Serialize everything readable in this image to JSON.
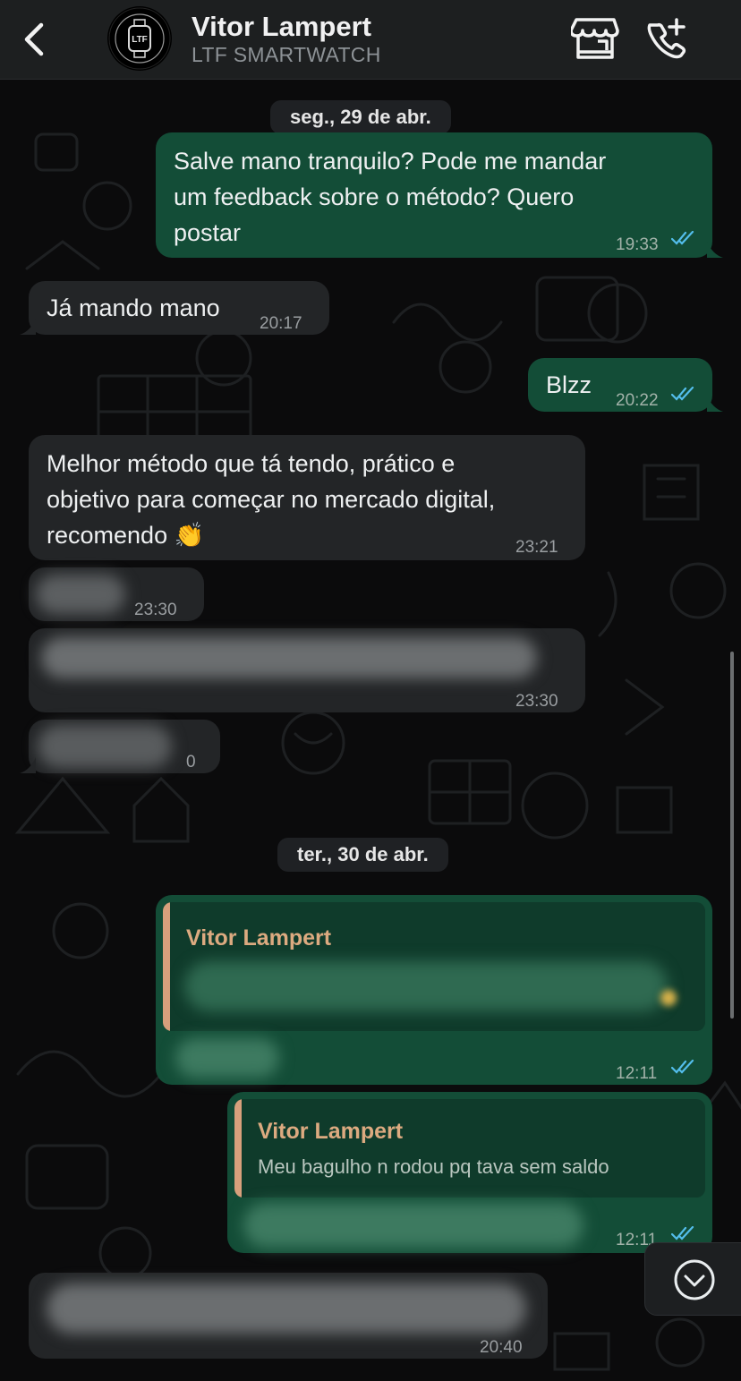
{
  "header": {
    "back_icon": "chevron-left-icon",
    "avatar_text": "LTF",
    "contact_name": "Vitor Lampert",
    "contact_subtitle": "LTF SMARTWATCH",
    "store_icon": "storefront-icon",
    "call_icon": "add-call-icon"
  },
  "dates": {
    "day1": "seg., 29 de abr.",
    "day2": "ter., 30 de abr."
  },
  "messages": [
    {
      "dir": "out",
      "text": "Salve mano tranquilo? Pode me mandar um feedback sobre o método? Quero postar",
      "time": "19:33",
      "status": "read"
    },
    {
      "dir": "in",
      "text": "Já mando mano",
      "time": "20:17"
    },
    {
      "dir": "out",
      "text": "Blzz",
      "time": "20:22",
      "status": "read"
    },
    {
      "dir": "in",
      "text": "Melhor método que tá tendo, prático e objetivo para começar no mercado digital, recomendo 👏",
      "time": "23:21"
    },
    {
      "dir": "in",
      "text": "",
      "time": "23:30",
      "blurred": true
    },
    {
      "dir": "in",
      "text": "",
      "time": "23:30",
      "blurred": true
    },
    {
      "dir": "in",
      "text": "",
      "time": "0",
      "blurred": true
    },
    {
      "dir": "out",
      "quote_author": "Vitor Lampert",
      "quote_text": "",
      "time": "12:11",
      "status": "read",
      "blurred": true
    },
    {
      "dir": "out",
      "quote_author": "Vitor Lampert",
      "quote_text": "Meu bagulho n rodou pq tava sem saldo",
      "time": "12:11",
      "status": "read",
      "blurred": true
    },
    {
      "dir": "in",
      "text": "",
      "time": "20:40",
      "blurred": true
    }
  ],
  "lines": {
    "m1_l1": "Salve mano tranquilo? Pode me mandar",
    "m1_l2": "um feedback sobre o método? Quero",
    "m1_l3": "postar",
    "m4_l1": "Melhor método que tá tendo, prático e",
    "m4_l2": "objetivo para começar no mercado digital,",
    "m4_l3": "recomendo 👏"
  },
  "scroll_down_icon": "chevron-down-circle-icon",
  "colors": {
    "outgoing_bubble": "#134d37",
    "incoming_bubble": "#232527",
    "read_ticks": "#53bdeb",
    "quote_accent": "#d8a07c"
  }
}
